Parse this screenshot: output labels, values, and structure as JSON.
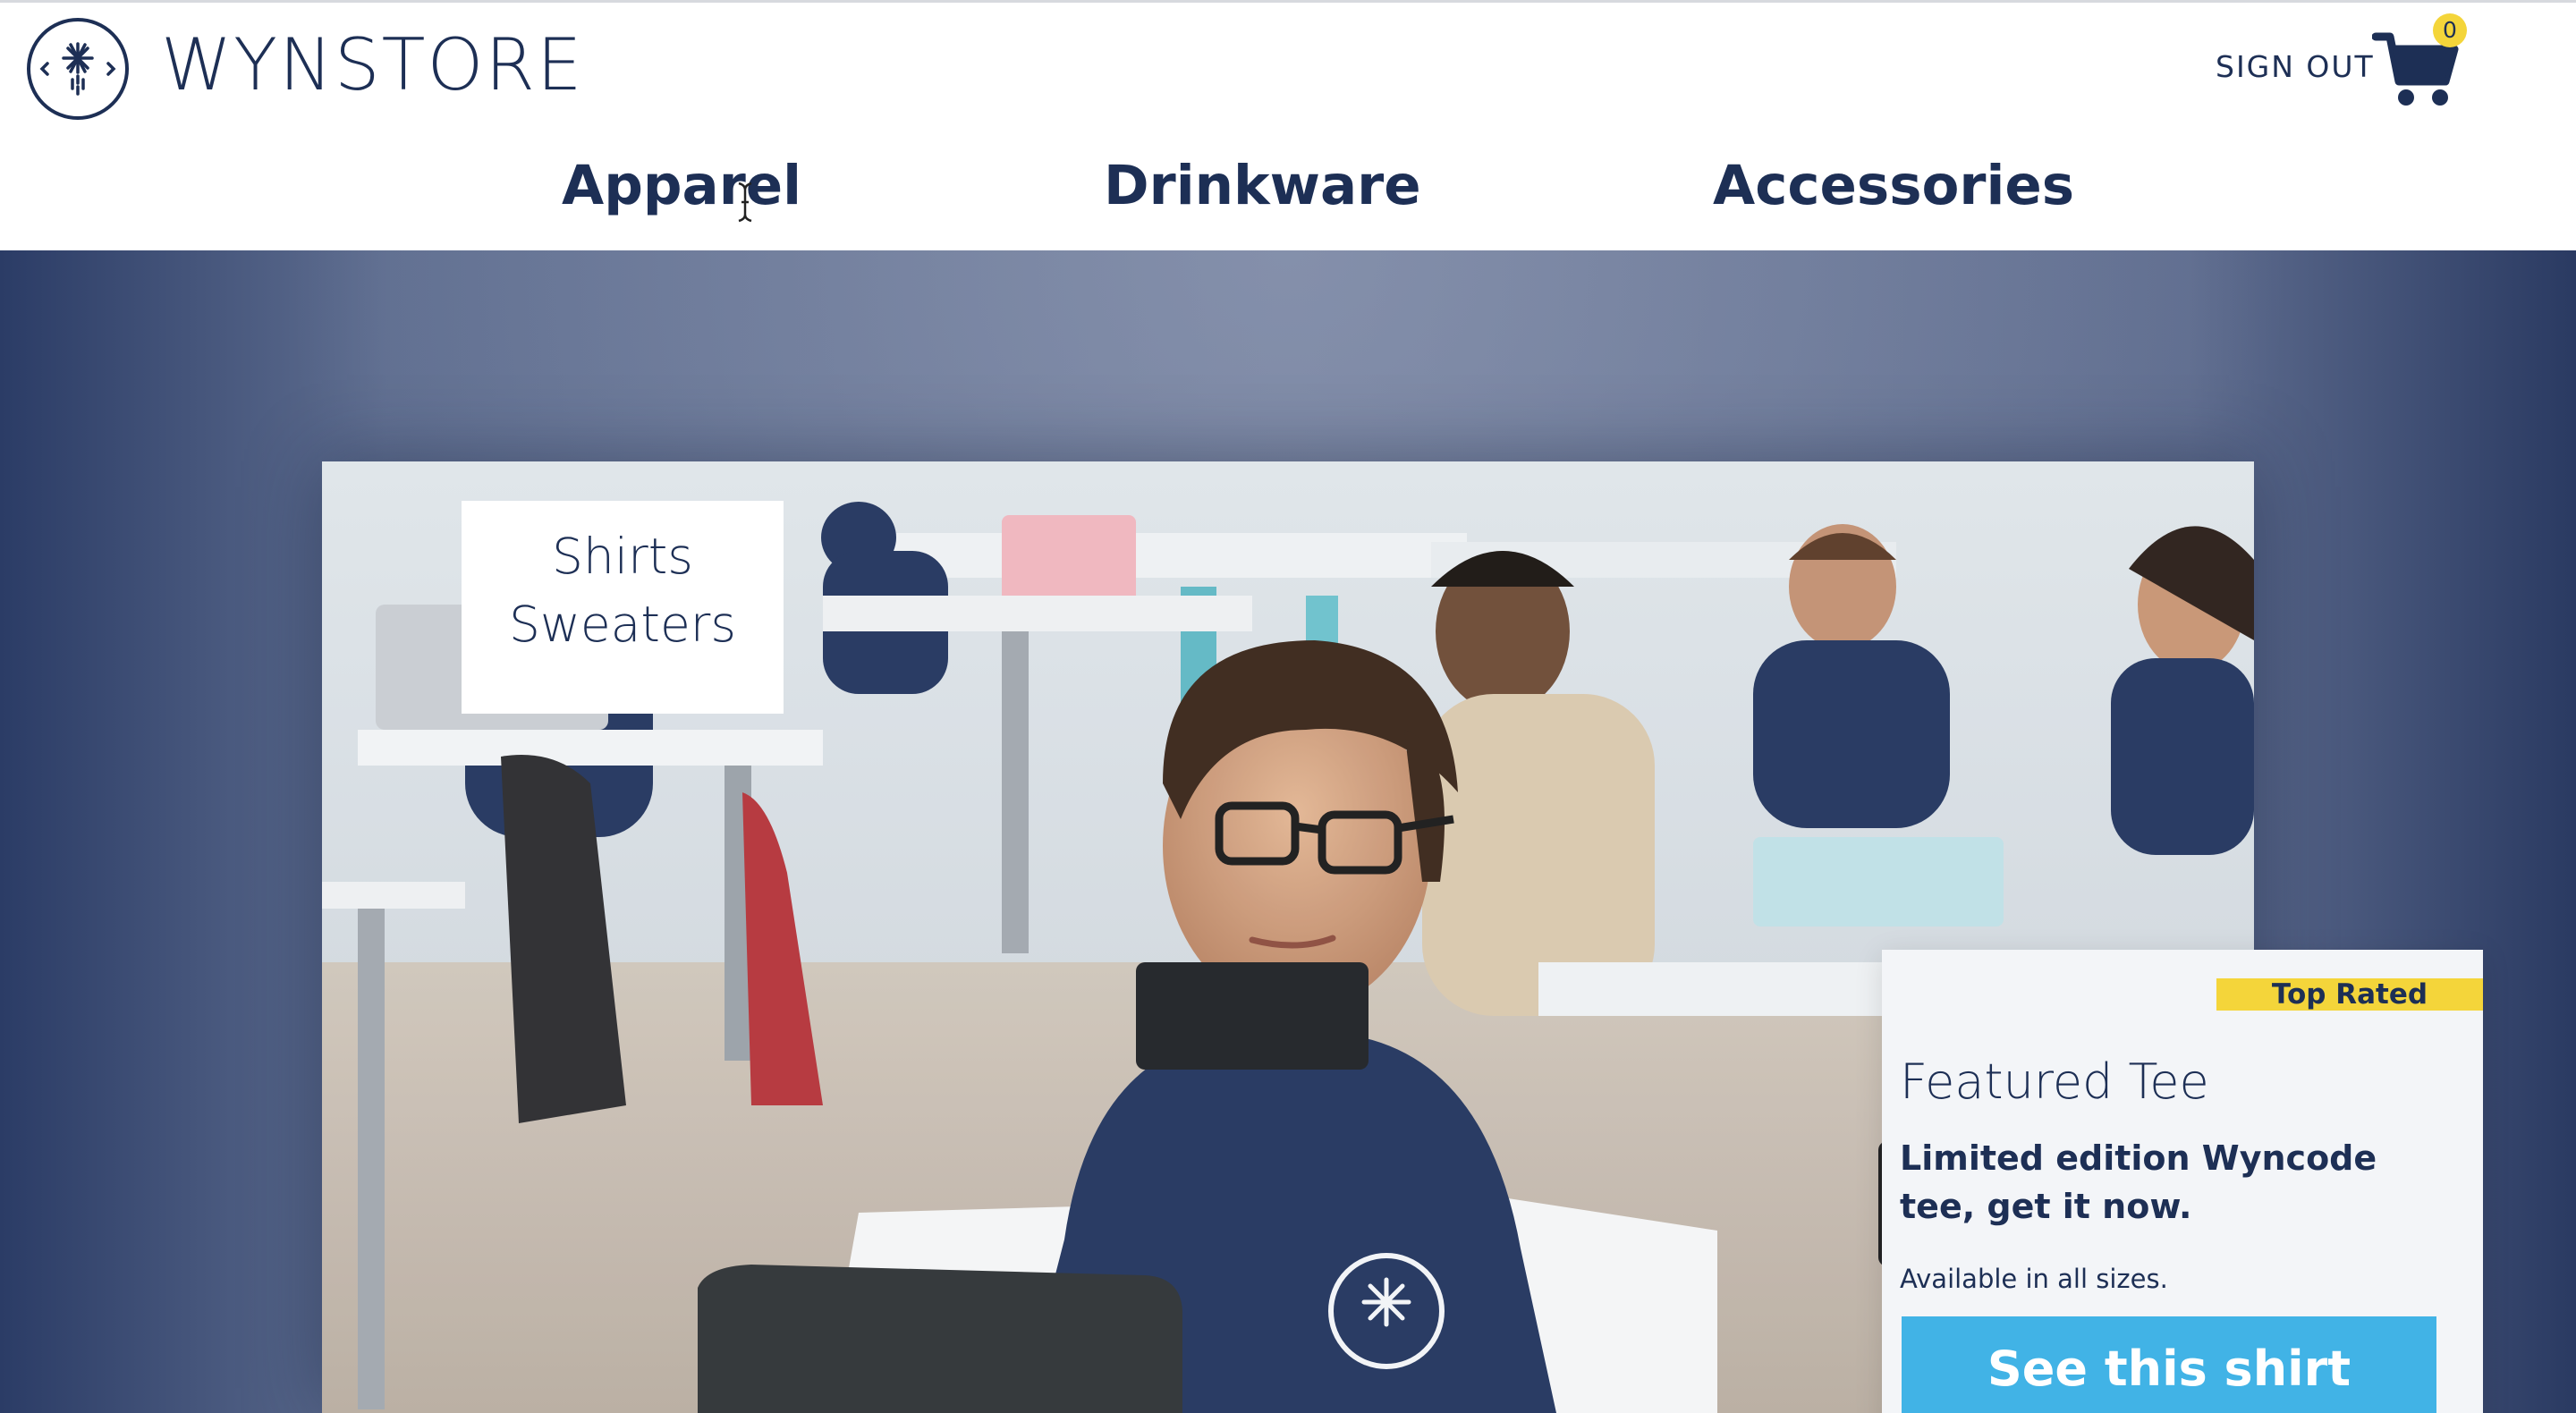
{
  "brand": {
    "name": "WYNSTORE",
    "logo_icon": "palm-star-icon"
  },
  "header": {
    "sign_out_label": "SIGN OUT",
    "cart_icon": "cart-icon",
    "cart_count": "0"
  },
  "nav": {
    "items": [
      {
        "label": "Apparel"
      },
      {
        "label": "Drinkware"
      },
      {
        "label": "Accessories"
      }
    ]
  },
  "dropdown": {
    "items": [
      {
        "label": "Shirts"
      },
      {
        "label": "Sweaters"
      }
    ]
  },
  "featured": {
    "badge": "Top Rated",
    "title": "Featured Tee",
    "subtitle": "Limited edition Wyncode tee, get it now.",
    "note": "Available in all sizes.",
    "button_label": "See this shirt"
  },
  "colors": {
    "primary_navy": "#1d2f55",
    "badge_yellow": "#f4d53a",
    "button_blue": "#41b3e6"
  }
}
